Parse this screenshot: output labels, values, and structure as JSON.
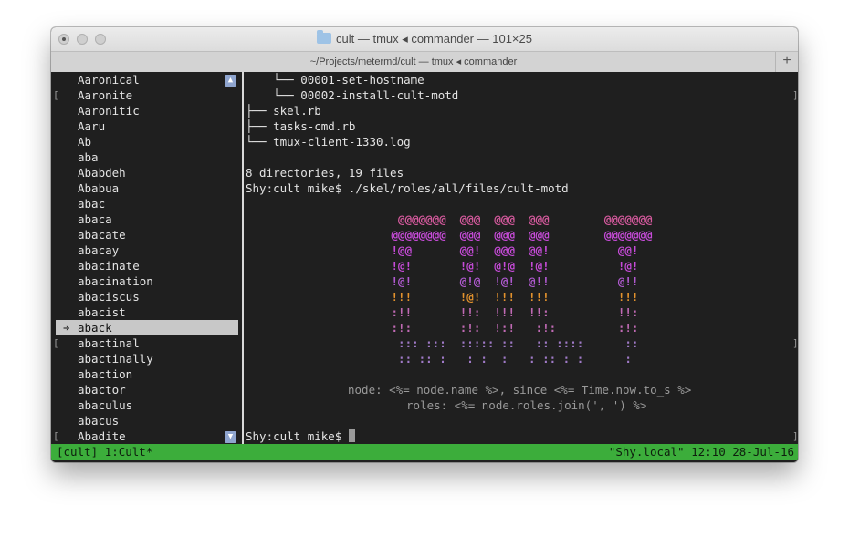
{
  "window": {
    "title": "cult — tmux ◂ commander — 101×25",
    "tab_label": "~/Projects/metermd/cult — tmux ◂ commander",
    "new_tab_symbol": "+"
  },
  "left_pane": {
    "items": [
      "Aaronical",
      "Aaronite",
      "Aaronitic",
      "Aaru",
      "Ab",
      "aba",
      "Ababdeh",
      "Ababua",
      "abac",
      "abaca",
      "abacate",
      "abacay",
      "abacinate",
      "abacination",
      "abaciscus",
      "abacist",
      "aback",
      "abactinal",
      "abactinally",
      "abaction",
      "abactor",
      "abaculus",
      "abacus",
      "Abadite"
    ],
    "selected_index": 16,
    "selected_marker": "➔",
    "scroll_up_symbol": "▲",
    "scroll_down_symbol": "▼"
  },
  "right_pane": {
    "tree": [
      "    └── 00001-set-hostname",
      "    └── 00002-install-cult-motd",
      "├── skel.rb",
      "├── tasks-cmd.rb",
      "└── tmux-client-1330.log"
    ],
    "summary": "8 directories, 19 files",
    "command_line": "Shy:cult mike$ ./skel/roles/all/files/cult-motd",
    "art": [
      {
        "text": "  @@@@@@@  @@@  @@@  @@@        @@@@@@@",
        "color": "#d65a9e"
      },
      {
        "text": " @@@@@@@@  @@@  @@@  @@@        @@@@@@@",
        "color": "#c64bd8"
      },
      {
        "text": " !@@       @@!  @@@  @@!          @@!  ",
        "color": "#c64bd8"
      },
      {
        "text": " !@!       !@!  @!@  !@!          !@!  ",
        "color": "#c64bd8"
      },
      {
        "text": " !@!       @!@  !@!  @!!          @!!  ",
        "color": "#b05ad0"
      },
      {
        "text": " !!!       !@!  !!!  !!!          !!!  ",
        "color": "#e3922d"
      },
      {
        "text": " :!!       !!:  !!!  !!:          !!:  ",
        "color": "#c06ab4"
      },
      {
        "text": " :!:       :!:  !:!   :!:         :!:  ",
        "color": "#c06ab4"
      },
      {
        "text": "  ::: :::  ::::: ::   :: ::::      ::  ",
        "color": "#a07ac8"
      },
      {
        "text": "  :: :: :   : :  :   : :: : :      :   ",
        "color": "#a07ac8"
      }
    ],
    "motd_node": "node: <%= node.name %>, since <%= Time.now.to_s %>",
    "motd_roles": "roles: <%= node.roles.join(', ') %>",
    "prompt": "Shy:cult mike$ "
  },
  "statusbar": {
    "left": "[cult] 1:Cult*",
    "right": "\"Shy.local\" 12:10 28-Jul-16",
    "color": "#3cad3b"
  },
  "edge_brackets": {
    "open": "[",
    "close": "]"
  }
}
